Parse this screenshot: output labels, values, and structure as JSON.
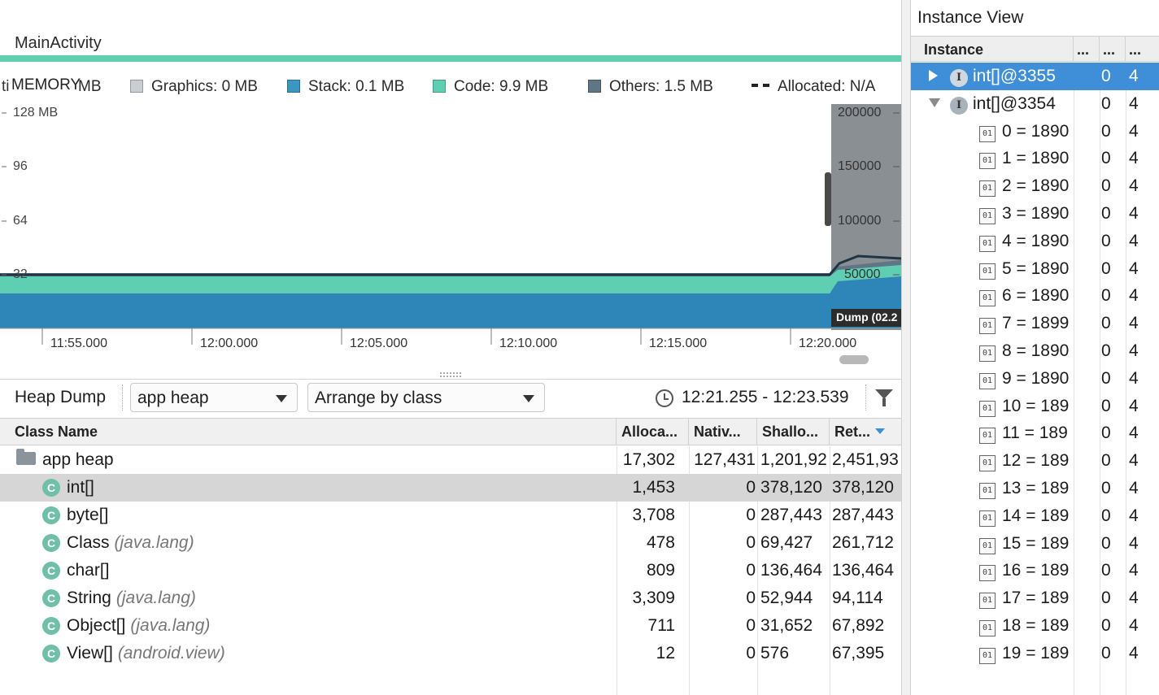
{
  "activity": {
    "name": "MainActivity"
  },
  "legend": {
    "total_fragment": "ti",
    "memory_label": "MEMORY",
    "overlap_fragment": "MB",
    "graphics": "Graphics: 0 MB",
    "stack": "Stack: 0.1 MB",
    "code": "Code: 9.9 MB",
    "others": "Others: 1.5 MB",
    "allocated": "Allocated: N/A"
  },
  "colors": {
    "java": "#2e86b8",
    "native": "#4fa0c8",
    "graphics": "#c9ced3",
    "stack": "#3b96c2",
    "code": "#5fcfb3",
    "others": "#5e7686",
    "accent": "#3f8fd8",
    "selected_row": "#d6d6d6"
  },
  "chart_data": {
    "type": "area",
    "y_left_ticks": [
      "128 MB",
      "96",
      "64",
      "32"
    ],
    "y_right_ticks": [
      "200000",
      "150000",
      "100000",
      "50000"
    ],
    "x_ticks": [
      "11:55.000",
      "12:00.000",
      "12:05.000",
      "12:10.000",
      "12:15.000",
      "12:20.000"
    ],
    "ylim": [
      0,
      128
    ],
    "series": [
      {
        "name": "Stack",
        "values_mb": [
          0.1,
          0.1
        ]
      },
      {
        "name": "Code",
        "values_mb": [
          9.9,
          9.9
        ]
      },
      {
        "name": "Others",
        "values_mb": [
          1.5,
          1.5
        ]
      }
    ],
    "dump_label": "Dump (02.2"
  },
  "heap_dump": {
    "title": "Heap Dump",
    "heap_select": "app heap",
    "arrange_select": "Arrange by class",
    "time_range": "12:21.255 - 12:23.539",
    "columns": [
      "Class Name",
      "Alloca...",
      "Nativ...",
      "Shallo...",
      "Ret..."
    ],
    "rows": [
      {
        "icon": "folder-icon",
        "name": "app heap",
        "pkg": "",
        "alloc": "17,302",
        "native": "127,431",
        "shallow": "1,201,92",
        "retained": "2,451,93",
        "selected": false
      },
      {
        "icon": "class-icon",
        "name": "int[]",
        "pkg": "",
        "alloc": "1,453",
        "native": "0",
        "shallow": "378,120",
        "retained": "378,120",
        "selected": true
      },
      {
        "icon": "class-icon",
        "name": "byte[]",
        "pkg": "",
        "alloc": "3,708",
        "native": "0",
        "shallow": "287,443",
        "retained": "287,443",
        "selected": false
      },
      {
        "icon": "class-icon",
        "name": "Class",
        "pkg": "(java.lang)",
        "alloc": "478",
        "native": "0",
        "shallow": "69,427",
        "retained": "261,712",
        "selected": false
      },
      {
        "icon": "class-icon",
        "name": "char[]",
        "pkg": "",
        "alloc": "809",
        "native": "0",
        "shallow": "136,464",
        "retained": "136,464",
        "selected": false
      },
      {
        "icon": "class-icon",
        "name": "String",
        "pkg": "(java.lang)",
        "alloc": "3,309",
        "native": "0",
        "shallow": "52,944",
        "retained": "94,114",
        "selected": false
      },
      {
        "icon": "class-icon",
        "name": "Object[]",
        "pkg": "(java.lang)",
        "alloc": "711",
        "native": "0",
        "shallow": "31,652",
        "retained": "67,892",
        "selected": false
      },
      {
        "icon": "class-icon",
        "name": "View[]",
        "pkg": "(android.view)",
        "alloc": "12",
        "native": "0",
        "shallow": "576",
        "retained": "67,395",
        "selected": false
      }
    ]
  },
  "instance_view": {
    "title": "Instance View",
    "columns": [
      "Instance",
      "...",
      "...",
      "..."
    ],
    "rows": [
      {
        "kind": "instance",
        "expander": "collapsed",
        "label": "int[]@3355",
        "c2": "0",
        "c3": "4",
        "selected": true
      },
      {
        "kind": "instance",
        "expander": "expanded",
        "label": "int[]@3354",
        "c2": "0",
        "c3": "4",
        "selected": false
      },
      {
        "kind": "field",
        "label": "0 = 1890",
        "c2": "0",
        "c3": "4"
      },
      {
        "kind": "field",
        "label": "1 = 1890",
        "c2": "0",
        "c3": "4"
      },
      {
        "kind": "field",
        "label": "2 = 1890",
        "c2": "0",
        "c3": "4"
      },
      {
        "kind": "field",
        "label": "3 = 1890",
        "c2": "0",
        "c3": "4"
      },
      {
        "kind": "field",
        "label": "4 = 1890",
        "c2": "0",
        "c3": "4"
      },
      {
        "kind": "field",
        "label": "5 = 1890",
        "c2": "0",
        "c3": "4"
      },
      {
        "kind": "field",
        "label": "6 = 1890",
        "c2": "0",
        "c3": "4"
      },
      {
        "kind": "field",
        "label": "7 = 1899",
        "c2": "0",
        "c3": "4"
      },
      {
        "kind": "field",
        "label": "8 = 1890",
        "c2": "0",
        "c3": "4"
      },
      {
        "kind": "field",
        "label": "9 = 1890",
        "c2": "0",
        "c3": "4"
      },
      {
        "kind": "field",
        "label": "10 = 189",
        "c2": "0",
        "c3": "4"
      },
      {
        "kind": "field",
        "label": "11 = 189",
        "c2": "0",
        "c3": "4"
      },
      {
        "kind": "field",
        "label": "12 = 189",
        "c2": "0",
        "c3": "4"
      },
      {
        "kind": "field",
        "label": "13 = 189",
        "c2": "0",
        "c3": "4"
      },
      {
        "kind": "field",
        "label": "14 = 189",
        "c2": "0",
        "c3": "4"
      },
      {
        "kind": "field",
        "label": "15 = 189",
        "c2": "0",
        "c3": "4"
      },
      {
        "kind": "field",
        "label": "16 = 189",
        "c2": "0",
        "c3": "4"
      },
      {
        "kind": "field",
        "label": "17 = 189",
        "c2": "0",
        "c3": "4"
      },
      {
        "kind": "field",
        "label": "18 = 189",
        "c2": "0",
        "c3": "4"
      },
      {
        "kind": "field",
        "label": "19 = 189",
        "c2": "0",
        "c3": "4"
      }
    ]
  }
}
